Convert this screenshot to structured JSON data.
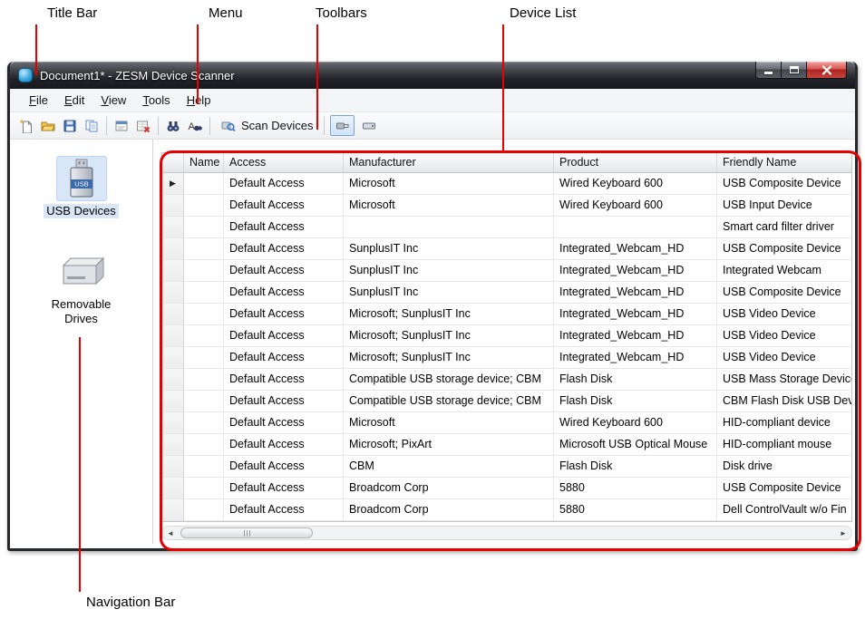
{
  "annotations": {
    "title_bar": "Title Bar",
    "menu": "Menu",
    "toolbars": "Toolbars",
    "device_list": "Device List",
    "navigation_bar": "Navigation Bar",
    "line_color": "#e60000"
  },
  "window": {
    "title": "Document1* - ZESM Device Scanner"
  },
  "menu": {
    "items": [
      "File",
      "Edit",
      "View",
      "Tools",
      "Help"
    ]
  },
  "toolbar": {
    "scan_devices_label": "Scan Devices",
    "icons": [
      "new-document-icon",
      "open-folder-icon",
      "save-icon",
      "copy-icon",
      "export-grid-icon",
      "delete-row-icon",
      "find-icon",
      "find-next-icon",
      "scan-devices-icon",
      "usb-view-toggle-icon",
      "removable-view-toggle-icon"
    ]
  },
  "nav": {
    "items": [
      {
        "label": "USB Devices",
        "selected": true
      },
      {
        "label": "Removable Drives",
        "selected": false
      }
    ]
  },
  "device_list": {
    "columns": [
      "",
      "Name",
      "Access",
      "Manufacturer",
      "Product",
      "Friendly Name"
    ],
    "active_row_index": 0,
    "active_row_marker": "▶",
    "rows": [
      [
        "Default Access",
        "Microsoft",
        "Wired Keyboard 600",
        "USB Composite Device"
      ],
      [
        "Default Access",
        "Microsoft",
        "Wired Keyboard 600",
        "USB Input Device"
      ],
      [
        "Default Access",
        "",
        "",
        "Smart card filter driver"
      ],
      [
        "Default Access",
        "SunplusIT Inc",
        "Integrated_Webcam_HD",
        "USB Composite Device"
      ],
      [
        "Default Access",
        "SunplusIT Inc",
        "Integrated_Webcam_HD",
        "Integrated Webcam"
      ],
      [
        "Default Access",
        "SunplusIT Inc",
        "Integrated_Webcam_HD",
        "USB Composite Device"
      ],
      [
        "Default Access",
        "Microsoft; SunplusIT Inc",
        "Integrated_Webcam_HD",
        "USB Video Device"
      ],
      [
        "Default Access",
        "Microsoft; SunplusIT Inc",
        "Integrated_Webcam_HD",
        "USB Video Device"
      ],
      [
        "Default Access",
        "Microsoft; SunplusIT Inc",
        "Integrated_Webcam_HD",
        "USB Video Device"
      ],
      [
        "Default Access",
        "Compatible USB storage device; CBM",
        "Flash Disk",
        "USB Mass Storage Device"
      ],
      [
        "Default Access",
        "Compatible USB storage device; CBM",
        "Flash Disk",
        "CBM Flash Disk USB Dev"
      ],
      [
        "Default Access",
        "Microsoft",
        "Wired Keyboard 600",
        "HID-compliant device"
      ],
      [
        "Default Access",
        "Microsoft; PixArt",
        "Microsoft USB Optical Mouse",
        "HID-compliant mouse"
      ],
      [
        "Default Access",
        "CBM",
        "Flash Disk",
        "Disk drive"
      ],
      [
        "Default Access",
        "Broadcom Corp",
        "5880",
        "USB Composite Device"
      ],
      [
        "Default Access",
        "Broadcom Corp",
        "5880",
        "Dell ControlVault w/o Fin"
      ]
    ]
  }
}
